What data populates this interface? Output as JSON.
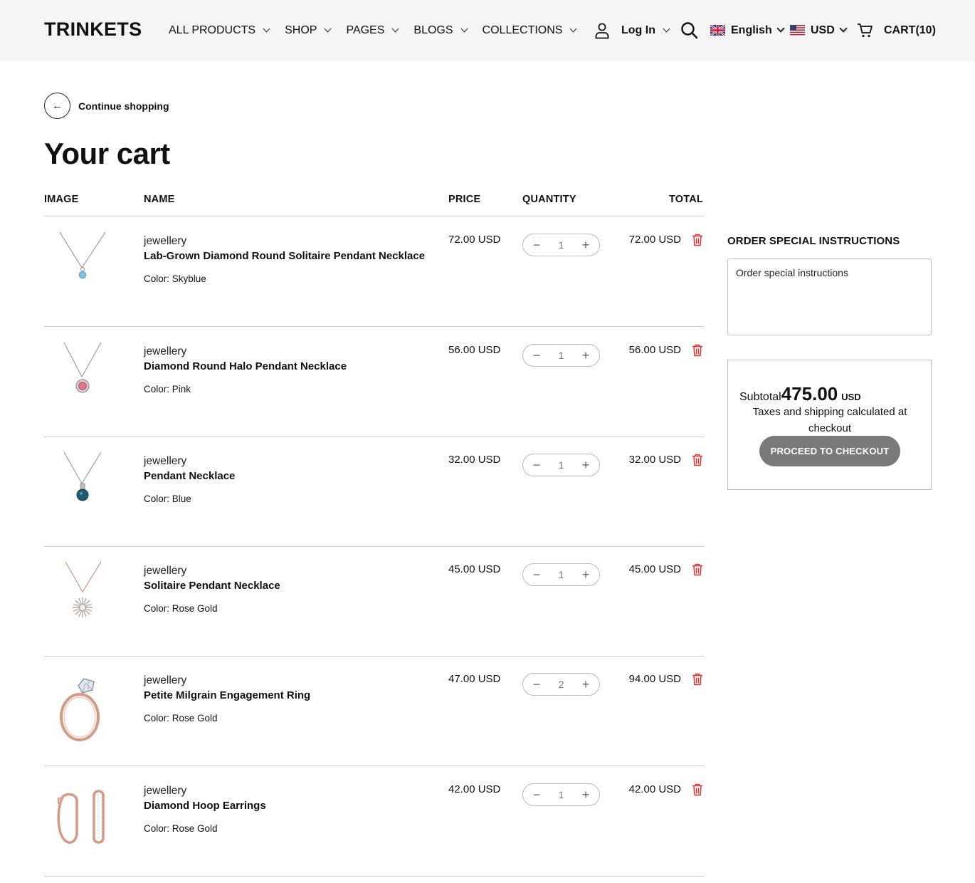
{
  "header": {
    "logo": "TRINKETS",
    "nav": [
      {
        "label": "ALL PRODUCTS"
      },
      {
        "label": "SHOP"
      },
      {
        "label": "PAGES"
      },
      {
        "label": "BLOGS"
      },
      {
        "label": "COLLECTIONS"
      }
    ],
    "login_label": "Log In",
    "language": "English",
    "currency": "USD",
    "cart_label": "CART(10)"
  },
  "back_link": {
    "label": "Continue shopping",
    "icon": "arrow-left-icon"
  },
  "page_title": "Your cart",
  "table": {
    "headers": {
      "image": "IMAGE",
      "name": "NAME",
      "price": "PRICE",
      "quantity": "QUANTITY",
      "total": "TOTAL"
    },
    "rows": [
      {
        "vendor": "jewellery",
        "name": "Lab-Grown Diamond Round Solitaire Pendant Necklace",
        "variant": "Color: Skyblue",
        "price": "72.00 USD",
        "quantity": "1",
        "total": "72.00 USD",
        "image": "pendant-necklace-skyblue"
      },
      {
        "vendor": "jewellery",
        "name": "Diamond Round Halo Pendant Necklace",
        "variant": "Color: Pink",
        "price": "56.00 USD",
        "quantity": "1",
        "total": "56.00 USD",
        "image": "halo-pendant-pink"
      },
      {
        "vendor": "jewellery",
        "name": "Pendant Necklace",
        "variant": "Color: Blue",
        "price": "32.00 USD",
        "quantity": "1",
        "total": "32.00 USD",
        "image": "pendant-necklace-blue"
      },
      {
        "vendor": "jewellery",
        "name": "Solitaire Pendant Necklace",
        "variant": "Color: Rose Gold",
        "price": "45.00 USD",
        "quantity": "1",
        "total": "45.00 USD",
        "image": "star-pendant-rose-gold"
      },
      {
        "vendor": "jewellery",
        "name": "Petite Milgrain Engagement Ring",
        "variant": "Color: Rose Gold",
        "price": "47.00 USD",
        "quantity": "2",
        "total": "94.00 USD",
        "image": "engagement-ring-rose-gold"
      },
      {
        "vendor": "jewellery",
        "name": "Diamond Hoop Earrings",
        "variant": "Color: Rose Gold",
        "price": "42.00 USD",
        "quantity": "1",
        "total": "42.00 USD",
        "image": "hoop-earrings-rose-gold"
      }
    ]
  },
  "instructions": {
    "title": "ORDER SPECIAL INSTRUCTIONS",
    "placeholder": "Order special instructions"
  },
  "summary": {
    "subtotal_label": "Subtotal",
    "subtotal_value": "475.00",
    "subtotal_currency": "USD",
    "tax_note": "Taxes and shipping calculated at checkout",
    "checkout_label": "PROCEED TO CHECKOUT"
  },
  "colors": {
    "header_bg": "#f5f5f5",
    "trash_icon": "#e0312f",
    "checkout_button": "#7a7a7a",
    "divider": "#cfcfcf"
  }
}
